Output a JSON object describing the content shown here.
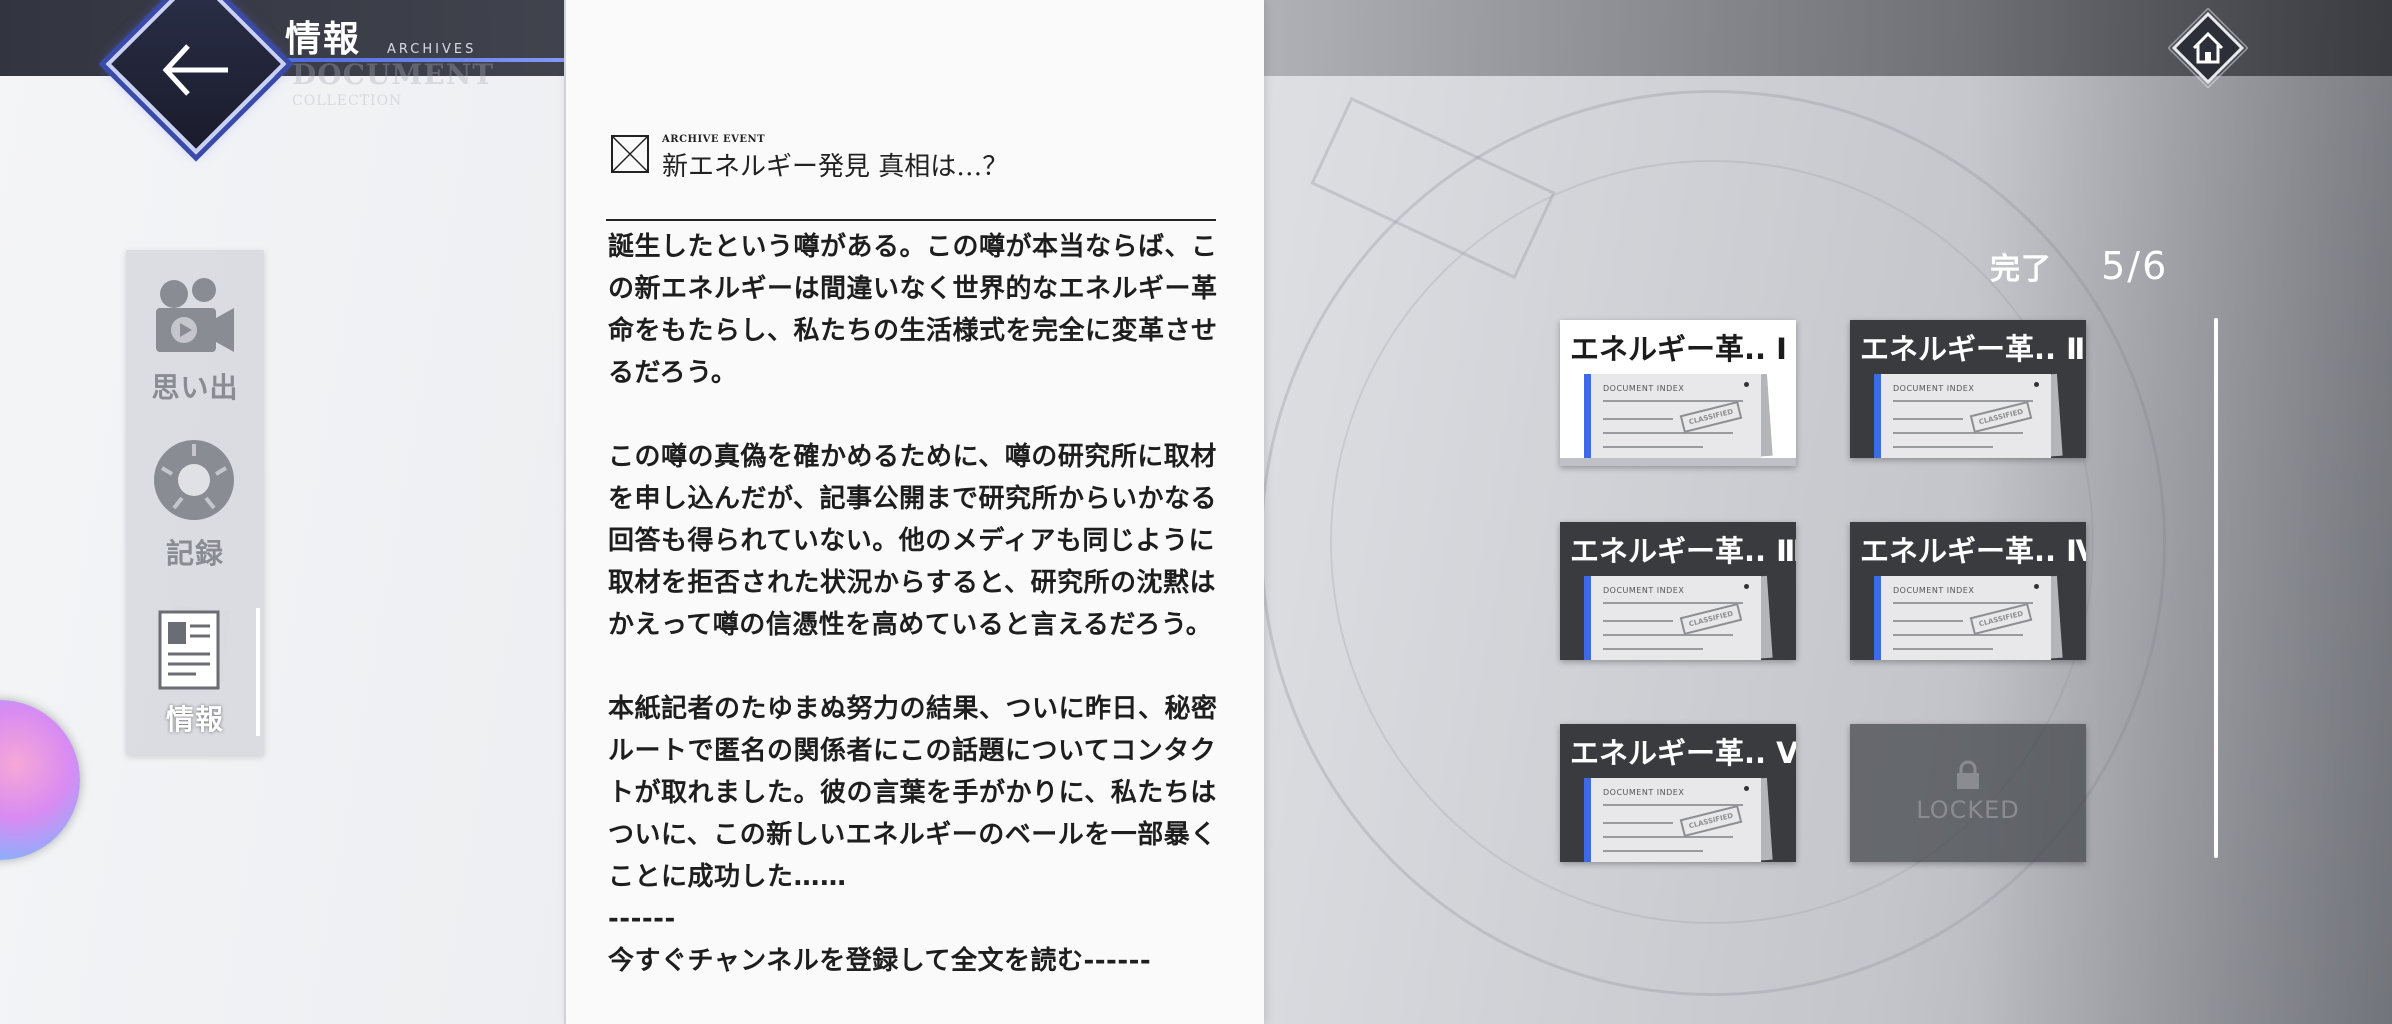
{
  "header": {
    "title": "情報",
    "subtitle": "ARCHIVES",
    "ghost_title": "DOCUMENT",
    "ghost_subtitle": "COLLECTION"
  },
  "side_menu": {
    "items": [
      {
        "label": "思い出",
        "icon": "video-camera-icon",
        "active": false
      },
      {
        "label": "記録",
        "icon": "record-disc-icon",
        "active": false
      },
      {
        "label": "情報",
        "icon": "document-stack-icon",
        "active": true
      }
    ]
  },
  "document": {
    "event_label": "ARCHIVE EVENT",
    "title": "新エネルギー発見 真相は…？",
    "paragraphs": [
      "誕生したという噂がある。この噂が本当ならば、この新エネルギーは間違いなく世界的なエネルギー革命をもたらし、私たちの生活様式を完全に変革させるだろう。",
      "この噂の真偽を確かめるために、噂の研究所に取材を申し込んだが、記事公開まで研究所からいかなる回答も得られていない。他のメディアも同じように取材を拒否された状況からすると、研究所の沈黙はかえって噂の信憑性を高めていると言えるだろう。",
      "本紙記者のたゆまぬ努力の結果、ついに昨日、秘密ルートで匿名の関係者にこの話題についてコンタクトが取れました。彼の言葉を手がかりに、私たちはついに、この新しいエネルギーのベールを一部暴くことに成功した……"
    ],
    "separator": "------",
    "footer": "今すぐチャンネルを登録して全文を読む------"
  },
  "progress": {
    "label": "完了",
    "value": "5/6"
  },
  "cards": [
    {
      "title": "エネルギー革.. Ⅰ",
      "state": "selected"
    },
    {
      "title": "エネルギー革.. Ⅱ",
      "state": "unlocked"
    },
    {
      "title": "エネルギー革.. Ⅲ",
      "state": "unlocked"
    },
    {
      "title": "エネルギー革.. Ⅳ",
      "state": "unlocked"
    },
    {
      "title": "エネルギー革.. Ⅴ",
      "state": "unlocked"
    },
    {
      "title": "",
      "state": "locked"
    }
  ],
  "card_paper": {
    "header": "DOCUMENT INDEX",
    "stamp": "CLASSIFIED"
  },
  "locked_label": "LOCKED",
  "colors": {
    "accent": "#3d6be8",
    "back_button_border": "#c9cff5",
    "card_bg": "#3a3b3f",
    "selected_card_bg": "#ffffff"
  }
}
